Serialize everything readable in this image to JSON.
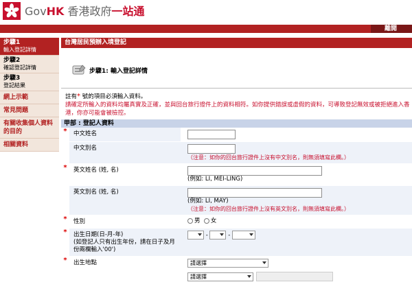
{
  "header": {
    "logo_gov": "Gov",
    "logo_hk": "HK",
    "logo_zh1": " 香港政府",
    "logo_zh2": "一站通",
    "exit_label": "離開"
  },
  "sidebar": {
    "steps": [
      {
        "title": "步驟1",
        "subtitle": "輸入登記詳情"
      },
      {
        "title": "步驟2",
        "subtitle": "確認登記詳情"
      },
      {
        "title": "步驟3",
        "subtitle": "登記結果"
      }
    ],
    "links": [
      "網上示範",
      "常見問題",
      "有關收集個人資料的目的",
      "相關資料"
    ]
  },
  "main": {
    "title": "台灣居民預辦入境登記",
    "step_title": "步驟1: 輸入登記詳情",
    "note_line1_prefix": "註有",
    "note_star": "*",
    "note_line1_suffix": " 號的項目必須輸入資料。",
    "note_red": "請確定所輸入的資料均屬真實及正確，並與回台旅行證件上的資料相符。如你提供錯誤或虛假的資料，可導致登記無效或被拒絕進入香港，你亦可能會被檢控。",
    "section_title": "甲部 : 登記人資料"
  },
  "form": {
    "chinese_name": {
      "star": "*",
      "label": "中文姓名"
    },
    "chinese_alias": {
      "label": "中文別名",
      "note": "（注意：如你的回台旅行證件上沒有中文別名，則無須填寫此欄。）"
    },
    "english_name": {
      "star": "*",
      "label": "英文姓名 (姓, 名)",
      "example": "(例如: LI, MEI-LING)"
    },
    "english_alias": {
      "label": "英文別名 (姓, 名)",
      "example": "(例如: LI, MAY)",
      "note": "（注意：如你的回台旅行證件上沒有英文別名，則無須填寫此欄。）"
    },
    "sex": {
      "star": "*",
      "label": "性別",
      "male": "男",
      "female": "女"
    },
    "dob": {
      "star": "*",
      "label": "出生日期(日-月-年)",
      "help": "(如登記人只有出生年份，請在日子及月份兩欄輸入'00')",
      "sep": "-"
    },
    "birthplace": {
      "star": "*",
      "label": "出生地點",
      "select1": "請選擇",
      "select2": "請選擇"
    }
  },
  "colors": {
    "brand_red": "#b22222",
    "dark_red": "#7a1717",
    "section_blue": "#c8d3e8",
    "row_blue": "#eef2f9",
    "sidebar_beige": "#f2e6dc"
  }
}
